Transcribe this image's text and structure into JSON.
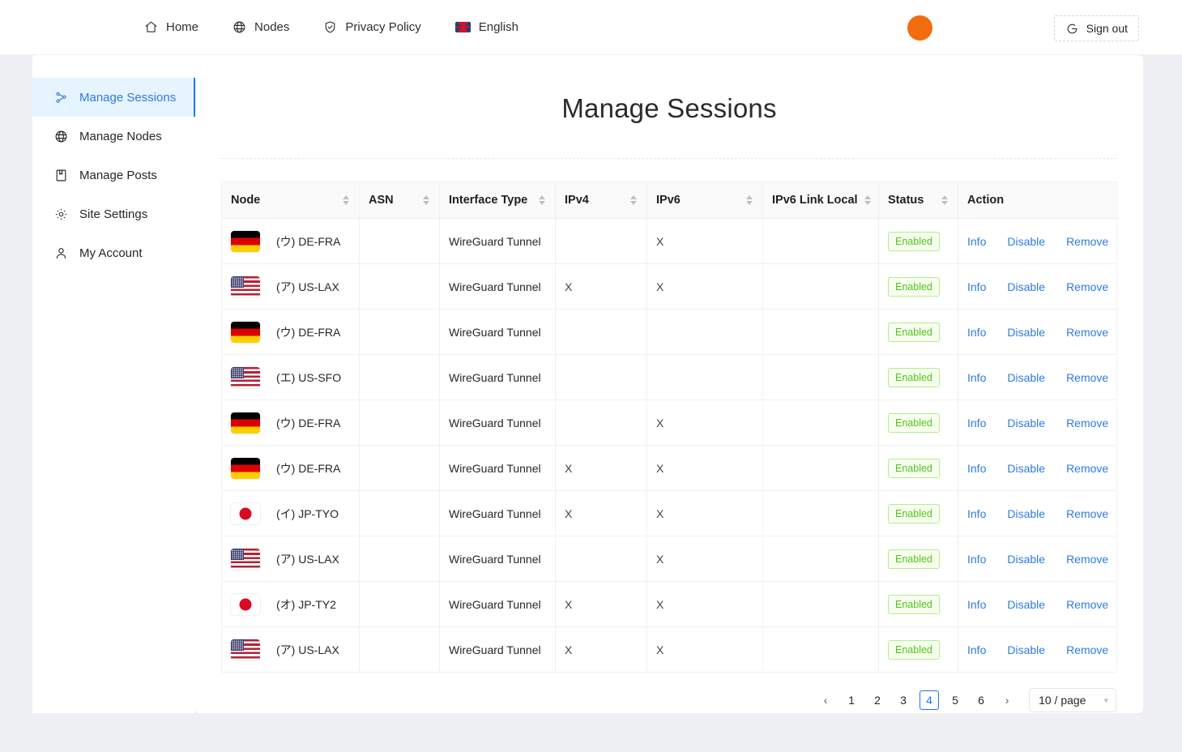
{
  "topnav": {
    "items": [
      {
        "label": "Home",
        "icon": "home-icon"
      },
      {
        "label": "Nodes",
        "icon": "globe-icon"
      },
      {
        "label": "Privacy Policy",
        "icon": "shield-check-icon"
      },
      {
        "label": "English",
        "icon": "uk-flag-icon"
      }
    ],
    "avatar_color": "#f26b0f",
    "signout_label": "Sign out",
    "signout_icon": "logout-icon"
  },
  "sidebar": {
    "items": [
      {
        "label": "Manage Sessions",
        "icon": "sessions-icon",
        "active": true
      },
      {
        "label": "Manage Nodes",
        "icon": "globe-icon",
        "active": false
      },
      {
        "label": "Manage Posts",
        "icon": "book-icon",
        "active": false
      },
      {
        "label": "Site Settings",
        "icon": "gear-icon",
        "active": false
      },
      {
        "label": "My Account",
        "icon": "user-icon",
        "active": false
      }
    ]
  },
  "main": {
    "title": "Manage Sessions",
    "table": {
      "columns": [
        {
          "label": "Node",
          "sortable": true
        },
        {
          "label": "ASN",
          "sortable": true
        },
        {
          "label": "Interface Type",
          "sortable": true
        },
        {
          "label": "IPv4",
          "sortable": true
        },
        {
          "label": "IPv6",
          "sortable": true
        },
        {
          "label": "IPv6 Link Local",
          "sortable": true
        },
        {
          "label": "Status",
          "sortable": true
        },
        {
          "label": "Action",
          "sortable": false
        }
      ],
      "rows": [
        {
          "flag": "de",
          "node": "(ウ) DE-FRA",
          "asn": "",
          "interface_type": "WireGuard Tunnel",
          "ipv4": "",
          "ipv6": "X",
          "ipv6_link_local": "",
          "status": "Enabled"
        },
        {
          "flag": "us",
          "node": "(ア) US-LAX",
          "asn": "",
          "interface_type": "WireGuard Tunnel",
          "ipv4": "X",
          "ipv6": "X",
          "ipv6_link_local": "",
          "status": "Enabled"
        },
        {
          "flag": "de",
          "node": "(ウ) DE-FRA",
          "asn": "",
          "interface_type": "WireGuard Tunnel",
          "ipv4": "",
          "ipv6": "",
          "ipv6_link_local": "",
          "status": "Enabled"
        },
        {
          "flag": "us",
          "node": "(エ) US-SFO",
          "asn": "",
          "interface_type": "WireGuard Tunnel",
          "ipv4": "",
          "ipv6": "",
          "ipv6_link_local": "",
          "status": "Enabled"
        },
        {
          "flag": "de",
          "node": "(ウ) DE-FRA",
          "asn": "",
          "interface_type": "WireGuard Tunnel",
          "ipv4": "",
          "ipv6": "X",
          "ipv6_link_local": "",
          "status": "Enabled"
        },
        {
          "flag": "de",
          "node": "(ウ) DE-FRA",
          "asn": "",
          "interface_type": "WireGuard Tunnel",
          "ipv4": "X",
          "ipv6": "X",
          "ipv6_link_local": "",
          "status": "Enabled"
        },
        {
          "flag": "jp",
          "node": "(イ) JP-TYO",
          "asn": "",
          "interface_type": "WireGuard Tunnel",
          "ipv4": "X",
          "ipv6": "X",
          "ipv6_link_local": "",
          "status": "Enabled"
        },
        {
          "flag": "us",
          "node": "(ア) US-LAX",
          "asn": "",
          "interface_type": "WireGuard Tunnel",
          "ipv4": "",
          "ipv6": "X",
          "ipv6_link_local": "",
          "status": "Enabled"
        },
        {
          "flag": "jp",
          "node": "(オ) JP-TY2",
          "asn": "",
          "interface_type": "WireGuard Tunnel",
          "ipv4": "X",
          "ipv6": "X",
          "ipv6_link_local": "",
          "status": "Enabled"
        },
        {
          "flag": "us",
          "node": "(ア) US-LAX",
          "asn": "",
          "interface_type": "WireGuard Tunnel",
          "ipv4": "X",
          "ipv6": "X",
          "ipv6_link_local": "",
          "status": "Enabled"
        }
      ],
      "action_labels": {
        "info": "Info",
        "disable": "Disable",
        "remove": "Remove"
      }
    },
    "pagination": {
      "prev": "‹",
      "next": "›",
      "pages": [
        "1",
        "2",
        "3",
        "4",
        "5",
        "6"
      ],
      "current": "4",
      "page_size_label": "10 / page"
    }
  },
  "colors": {
    "accent": "#1677ff",
    "link": "#2f7ae5",
    "status_green": "#52c41a",
    "page_bg": "#eff0f4"
  }
}
